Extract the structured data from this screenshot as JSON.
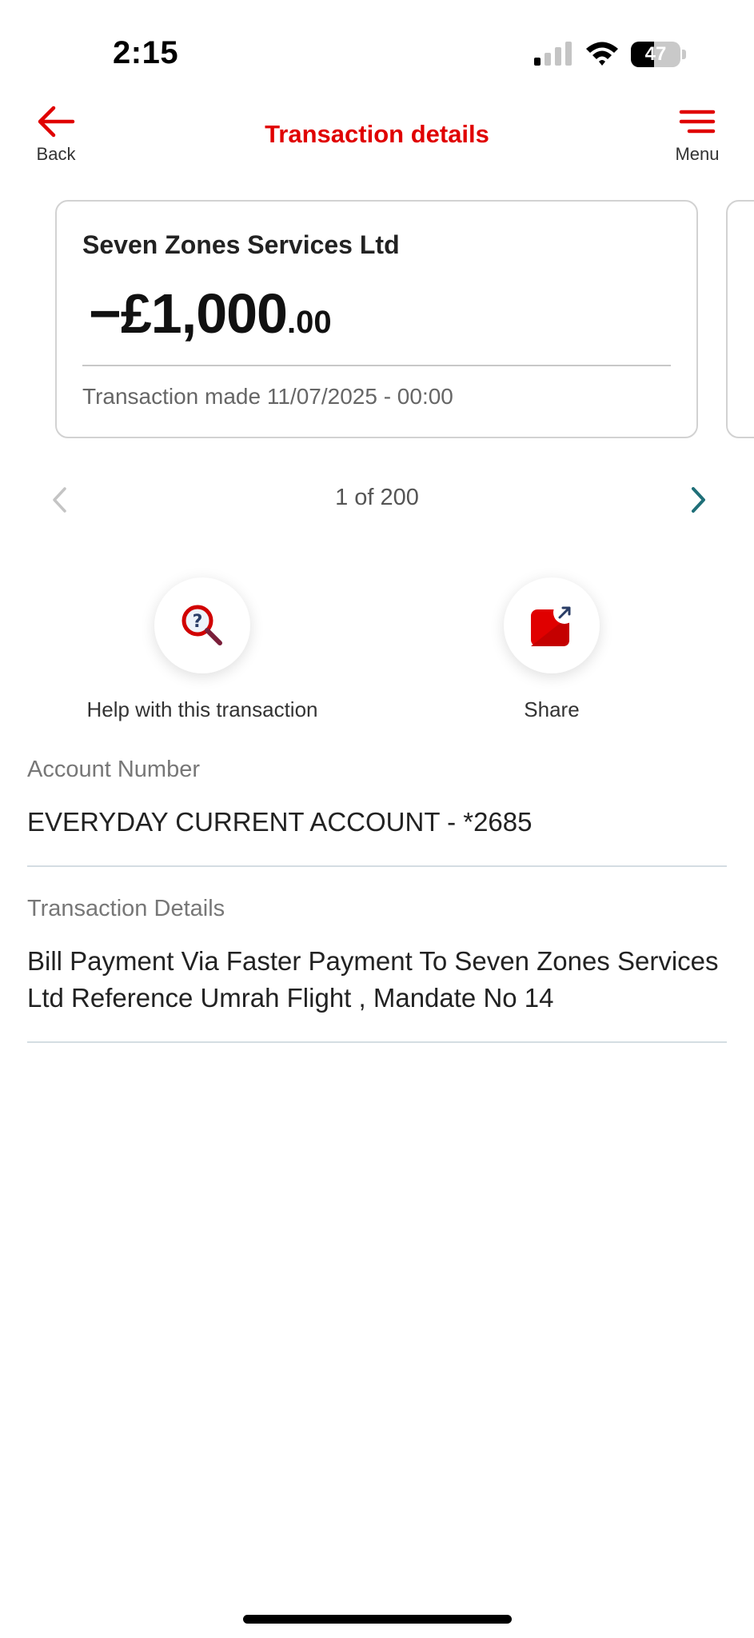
{
  "status_bar": {
    "time": "2:15",
    "battery_level": "47",
    "battery_fraction": 0.47
  },
  "header": {
    "back_label": "Back",
    "title": "Transaction details",
    "menu_label": "Menu"
  },
  "card": {
    "merchant": "Seven Zones Services Ltd",
    "amount_main": "−£1,000",
    "amount_pence": ".00",
    "transaction_made_label": "Transaction made",
    "transaction_datetime": "11/07/2025 - 00:00"
  },
  "pager": {
    "count_text": "1 of 200"
  },
  "actions": {
    "help_label": "Help with this transaction",
    "share_label": "Share"
  },
  "details": {
    "account_label": "Account Number",
    "account_value": "EVERYDAY CURRENT ACCOUNT - *2685",
    "transaction_label": "Transaction Details",
    "transaction_value": "Bill Payment Via Faster Payment To Seven Zones Services Ltd Reference Umrah Flight , Mandate No 14"
  },
  "colors": {
    "brand_red": "#e00000",
    "pager_next": "#1f6f78",
    "pager_prev_disabled": "#c4c4c4"
  }
}
